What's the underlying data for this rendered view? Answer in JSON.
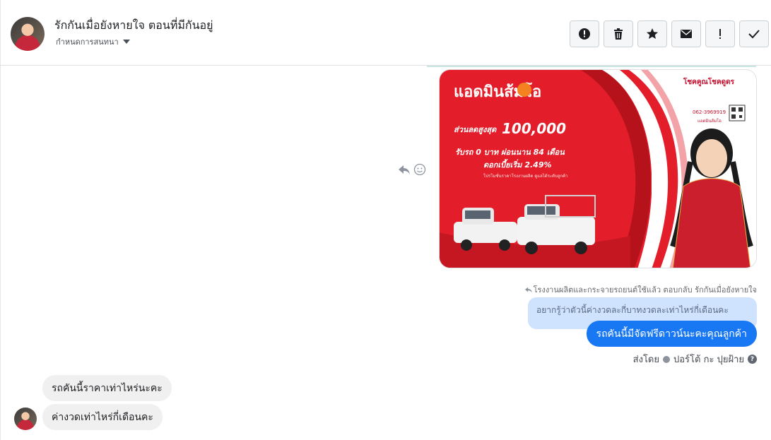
{
  "header": {
    "title": "รักกันเมื่อยังหายใจ ตอนที่มีกันอยู่",
    "subtitle": "กำหนดการสนทนา",
    "actions": [
      {
        "icon": "alert-circle-icon"
      },
      {
        "icon": "trash-icon"
      },
      {
        "icon": "star-icon"
      },
      {
        "icon": "envelope-icon"
      },
      {
        "icon": "exclamation-icon"
      },
      {
        "icon": "check-icon"
      }
    ]
  },
  "image_ad": {
    "brand": "แอดมินส้มโอ",
    "discount_label": "ส่วนลดสูงสุด",
    "discount_value": "100,000",
    "line1": "รับรถ 0 บาท ผ่อนนาน 84 เดือน",
    "line2": "ดอกเบี้ยเริ่ม 2.49%",
    "small_note": "โปรโมชั่นราคาโรงงานผลิต ดูแลได้ระดับลูกค้า",
    "right_title": "โชคคูณโชคดูดร",
    "phone": "062-3969919",
    "right_name": "แอดมินส้มโอ"
  },
  "conversation": {
    "reply_note": "โรงงานผลิตและกระจายรถยนต์ใช้แล้ว ตอบกลับ รักกันเมื่อยังหายใจ",
    "quoted_text": "อยากรู้ว่าตัวนี้ค่างวดละกี่บาทงวดละเท่าไหร่กี่เดือนคะ",
    "outgoing_text": "รถคันนี้มีจัดฟรีดาวน์นะคะคุณลูกค้า",
    "sent_by_prefix": "ส่งโดย",
    "sent_by_name": "ปอร์โต้ กะ ปุยฝ้าย",
    "incoming": [
      "รถคันนี้ราคาเท่าไหร่นะคะ",
      "ค่างวดเท่าไหร่กี่เดือนคะ"
    ]
  },
  "colors": {
    "accent": "#1877f2",
    "quoted_bg": "#cfe3ff",
    "incoming_bg": "#f0f0f0",
    "ad_red": "#e31e2a"
  }
}
